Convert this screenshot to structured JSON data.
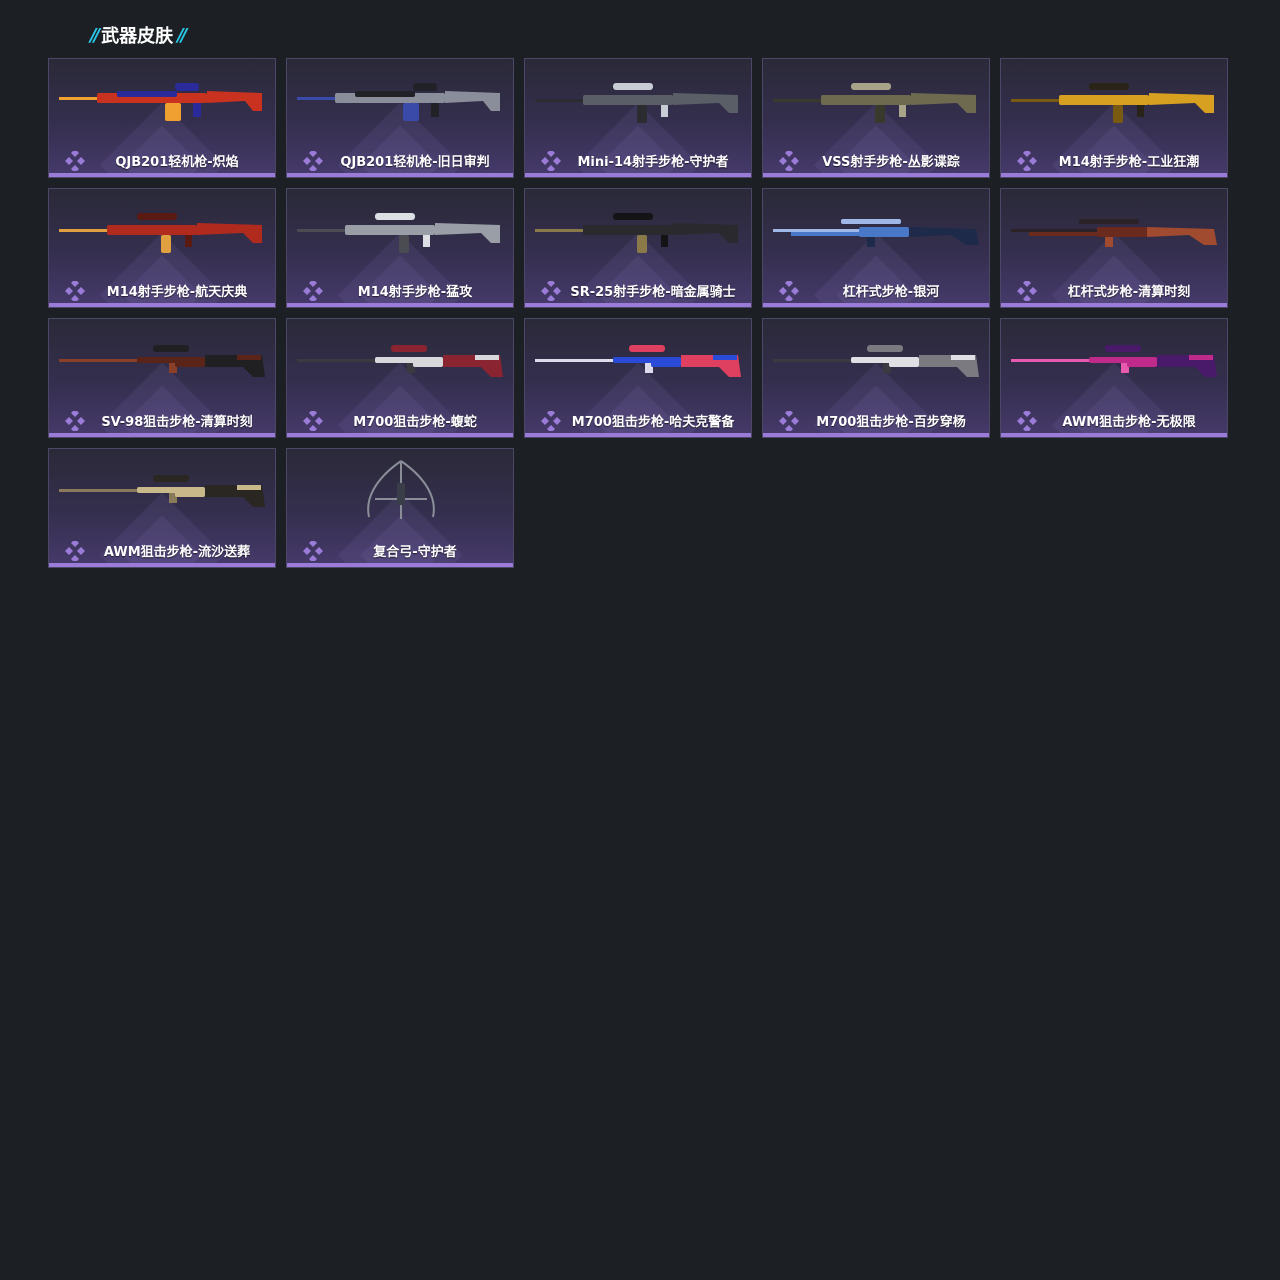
{
  "section": {
    "title": "武器皮肤",
    "slash_left": "//",
    "slash_right": "//"
  },
  "colors": {
    "background": "#1c2024",
    "accent_slash": "#29c7e8",
    "rarity_purple": "#9a7cd8",
    "card_border": "#4c4766"
  },
  "skins": [
    {
      "name": "QJB201轻机枪-炽焰",
      "icon": "lmg-icon",
      "colors": [
        "#c8321e",
        "#f0a030",
        "#2a2a9a"
      ]
    },
    {
      "name": "QJB201轻机枪-旧日审判",
      "icon": "lmg-icon",
      "colors": [
        "#8a8e9a",
        "#3a4aa8",
        "#202228"
      ]
    },
    {
      "name": "Mini-14射手步枪-守护者",
      "icon": "rifle-icon",
      "colors": [
        "#5a5e66",
        "#2a2c30",
        "#c8ccd4"
      ]
    },
    {
      "name": "VSS射手步枪-丛影谍踪",
      "icon": "rifle-icon",
      "colors": [
        "#6e6a50",
        "#3a3a2c",
        "#a8a48a"
      ]
    },
    {
      "name": "M14射手步枪-工业狂潮",
      "icon": "rifle-icon",
      "colors": [
        "#d8a020",
        "#7a5a10",
        "#2a2418"
      ]
    },
    {
      "name": "M14射手步枪-航天庆典",
      "icon": "rifle-icon",
      "colors": [
        "#b02a1e",
        "#e0a040",
        "#5a1a12"
      ]
    },
    {
      "name": "M14射手步枪-猛攻",
      "icon": "rifle-icon",
      "colors": [
        "#9a9ea6",
        "#4a4c52",
        "#dcdfe4"
      ]
    },
    {
      "name": "SR-25射手步枪-暗金属骑士",
      "icon": "rifle-icon",
      "colors": [
        "#2a2a2e",
        "#8a7a4a",
        "#141416"
      ]
    },
    {
      "name": "杠杆式步枪-银河",
      "icon": "lever-rifle-icon",
      "colors": [
        "#4a78c8",
        "#a0b8e8",
        "#1e2a4a"
      ]
    },
    {
      "name": "杠杆式步枪-清算时刻",
      "icon": "lever-rifle-icon",
      "colors": [
        "#6a2a1e",
        "#2a2226",
        "#a04a30"
      ]
    },
    {
      "name": "SV-98狙击步枪-清算时刻",
      "icon": "sniper-icon",
      "colors": [
        "#5a2418",
        "#202022",
        "#8a4028"
      ]
    },
    {
      "name": "M700狙击步枪-蝮蛇",
      "icon": "sniper-icon",
      "colors": [
        "#d8d8dc",
        "#8a2430",
        "#3a3a40"
      ]
    },
    {
      "name": "M700狙击步枪-哈夫克警备",
      "icon": "sniper-icon",
      "colors": [
        "#2a4ad8",
        "#e04060",
        "#dcdcec"
      ]
    },
    {
      "name": "M700狙击步枪-百步穿杨",
      "icon": "sniper-icon",
      "colors": [
        "#e0e0e4",
        "#7a7a80",
        "#3a3a40"
      ]
    },
    {
      "name": "AWM狙击步枪-无极限",
      "icon": "sniper-icon",
      "colors": [
        "#c02a8a",
        "#4a1a6a",
        "#e85ab0"
      ]
    },
    {
      "name": "AWM狙击步枪-流沙送葬",
      "icon": "sniper-icon",
      "colors": [
        "#c8b88a",
        "#2a2622",
        "#8a7a5a"
      ]
    },
    {
      "name": "复合弓-守护者",
      "icon": "bow-icon",
      "colors": [
        "#3a3e48",
        "#8a8e98",
        "#1e2026"
      ]
    }
  ]
}
